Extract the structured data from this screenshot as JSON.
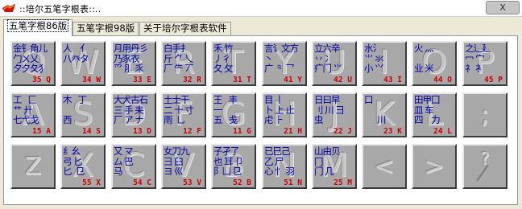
{
  "window": {
    "title": "::培尔五笔字根表::..",
    "close_label": "X"
  },
  "tabs": [
    {
      "label": "五笔字根86版",
      "active": true
    },
    {
      "label": "五笔字根98版",
      "active": false
    },
    {
      "label": "关于培尔字根表软件",
      "active": false
    }
  ],
  "colors": {
    "root_text": "#0000aa",
    "code_text": "#cc0000",
    "key_face": "#a8a8a8"
  },
  "keys": [
    {
      "letter": "Q",
      "code": "35 Q",
      "roots": "金钅角儿\n勹ㄨ乂\n夕夕夂犭"
    },
    {
      "letter": "W",
      "code": "34 W",
      "roots": "人    亻\n八癶タ"
    },
    {
      "letter": "E",
      "code": "33 E",
      "roots": "月用丹彡\n乃豕衣\n爫 ⺼ 乑"
    },
    {
      "letter": "R",
      "code": "32 R",
      "roots": "白手扌\n斤 ⺈ 乀\n厂 ⺧ 丆"
    },
    {
      "letter": "T",
      "code": "31 T",
      "roots": "禾 竹\n丿彳\n夂 攵"
    },
    {
      "letter": "Y",
      "code": "41 Y",
      "roots": "言讠文方\n丶\n广 ⺀ 乛"
    },
    {
      "letter": "U",
      "code": "42 U",
      "roots": "立六辛\n丷 冫\n疒门 ⺌"
    },
    {
      "letter": "I",
      "code": "43 I",
      "roots": "水氵\n⺌ 氺\n小 ⺍"
    },
    {
      "letter": "O",
      "code": "44 O",
      "roots": "火 灬\n\n业 米"
    },
    {
      "letter": "P",
      "code": "45 P",
      "roots": "之辶廴\n冖 宀\n礻 衤"
    },
    {
      "letter": "A",
      "code": "15 A",
      "roots": "工   匚\n艹 廾\n七弋戈"
    },
    {
      "letter": "S",
      "code": "14 S",
      "roots": "木   丁\n\n西"
    },
    {
      "letter": "D",
      "code": "13 D",
      "roots": "大犬古石\n三 手 耒\n厂 ア ナ"
    },
    {
      "letter": "F",
      "code": "12 F",
      "roots": "土士干\n二 十 寸\n雨  ⺃"
    },
    {
      "letter": "G",
      "code": "11 G",
      "roots": "王   丰\n一\n五   戋"
    },
    {
      "letter": "H",
      "code": "21 H",
      "roots": "目 丨\n卜 上 止\n虍 ⺊"
    },
    {
      "letter": "J",
      "code": "22 J",
      "roots": "日曰早\n刂 川 ⺕\n虫   "
    },
    {
      "letter": "K",
      "code": "23 K",
      "roots": "口\n\n      川"
    },
    {
      "letter": "L",
      "code": "24 L",
      "roots": "田甲囗\n皿 车 \n四    力"
    },
    {
      "letter": ";",
      "code": "",
      "roots": "",
      "symbol": ";"
    },
    {
      "letter": "Z",
      "code": "",
      "roots": "",
      "symbol": "Z"
    },
    {
      "letter": "X",
      "code": "55 X",
      "roots": "纟幺\n弓 匕\n匕  ⺋"
    },
    {
      "letter": "C",
      "code": "54 C",
      "roots": "又 マ\n厶 巴\n马"
    },
    {
      "letter": "V",
      "code": "53 V",
      "roots": "女刀九\n彐 臼\nヨ 巛"
    },
    {
      "letter": "B",
      "code": "52 B",
      "roots": "子孑了\n也 耳 卩\n阝凵 ⺋"
    },
    {
      "letter": "N",
      "code": "51 N",
      "roots": "已巳己\n乙 尸\n心 忄 羽"
    },
    {
      "letter": "M",
      "code": "25 M",
      "roots": "山由贝\n冂\n门 几"
    },
    {
      "letter": ",",
      "code": "",
      "roots": "",
      "symbol": "<"
    },
    {
      "letter": ".",
      "code": "",
      "roots": "",
      "symbol": ">"
    },
    {
      "letter": "/",
      "code": "",
      "roots": "",
      "symbol": "?"
    }
  ]
}
